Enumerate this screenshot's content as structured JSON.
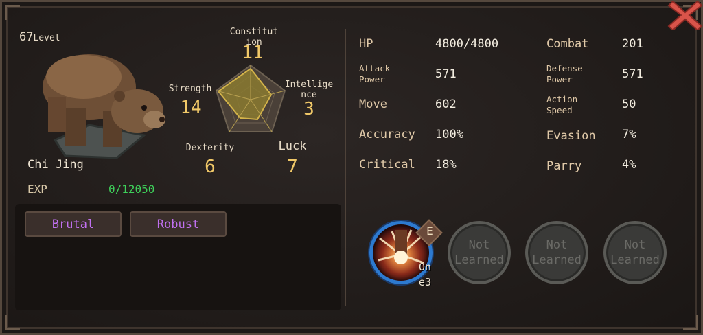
{
  "character": {
    "level_number": "67",
    "level_word": "Level",
    "name": "Chi Jing",
    "exp_label": "EXP",
    "exp_value": "0/12050"
  },
  "attributes": {
    "constitution": {
      "label": "Constitut\nion",
      "value": "11"
    },
    "strength": {
      "label": "Strength",
      "value": "14"
    },
    "intelligence": {
      "label": "Intellige\nnce",
      "value": "3"
    },
    "dexterity": {
      "label": "Dexterity",
      "value": "6"
    },
    "luck": {
      "label": "Luck",
      "value": "7"
    }
  },
  "traits": [
    "Brutal",
    "Robust"
  ],
  "stats": {
    "hp": {
      "label": "HP",
      "value": "4800/4800"
    },
    "attack_power": {
      "label": "Attack\nPower",
      "value": "571"
    },
    "move": {
      "label": "Move",
      "value": "602"
    },
    "accuracy": {
      "label": "Accuracy",
      "value": "100%"
    },
    "critical": {
      "label": "Critical",
      "value": "18%"
    },
    "combat": {
      "label": "Combat",
      "value": "201"
    },
    "defense_power": {
      "label": "Defense\nPower",
      "value": "571"
    },
    "action_speed": {
      "label": "Action\nSpeed",
      "value": "50"
    },
    "evasion": {
      "label": "Evasion",
      "value": "7%"
    },
    "parry": {
      "label": "Parry",
      "value": "4%"
    }
  },
  "skills": {
    "active_badge": "E",
    "active_note": "On\ne3",
    "locked_label": "Not\nLearned"
  },
  "colors": {
    "stat_value": "#f0c868",
    "exp_value": "#3ed05a",
    "trait_text": "#c070f0",
    "active_skill_ring": "#2d7ad0"
  },
  "icons": {
    "close": "close-x-icon",
    "portrait": "bear-portrait",
    "radar": "attribute-radar-chart"
  }
}
